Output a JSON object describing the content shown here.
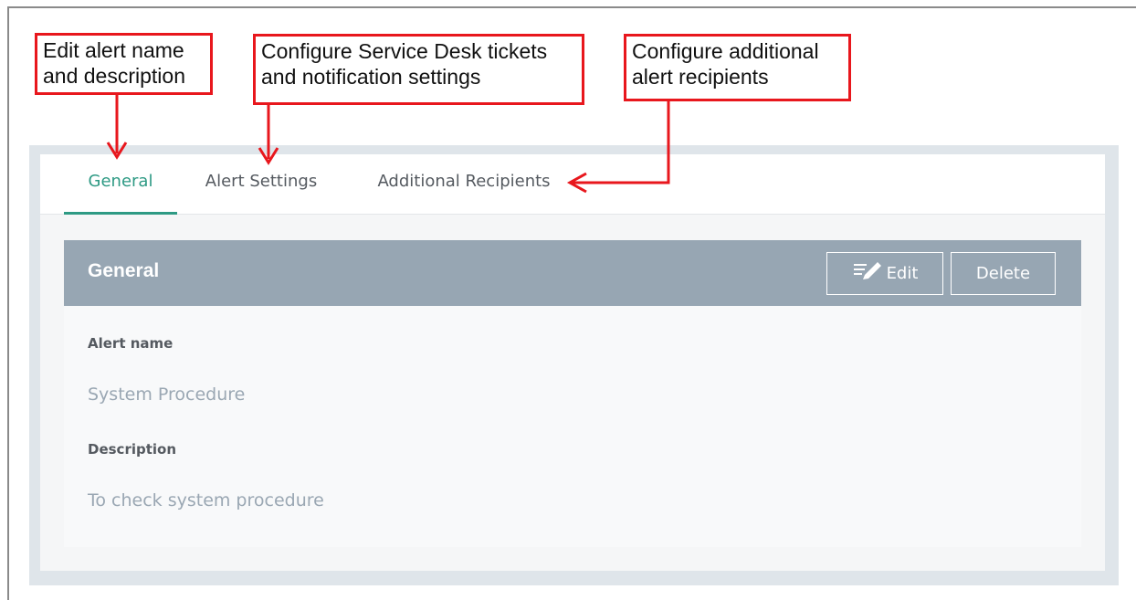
{
  "callouts": {
    "general": [
      "Edit alert name",
      "and description"
    ],
    "alert_settings": [
      "Configure Service Desk tickets",
      "and notification settings"
    ],
    "additional_recipients": [
      "Configure additional",
      "alert recipients"
    ]
  },
  "tabs": [
    {
      "label": "General",
      "active": true
    },
    {
      "label": "Alert Settings",
      "active": false
    },
    {
      "label": "Additional Recipients",
      "active": false
    }
  ],
  "section": {
    "title": "General",
    "edit_label": "Edit",
    "delete_label": "Delete"
  },
  "fields": {
    "alert_name_label": "Alert name",
    "alert_name_value": "System Procedure",
    "description_label": "Description",
    "description_value": "To check system procedure"
  },
  "colors": {
    "accent": "#2e9a84",
    "callout_border": "#e8171d",
    "header_bg": "#97a6b3"
  }
}
